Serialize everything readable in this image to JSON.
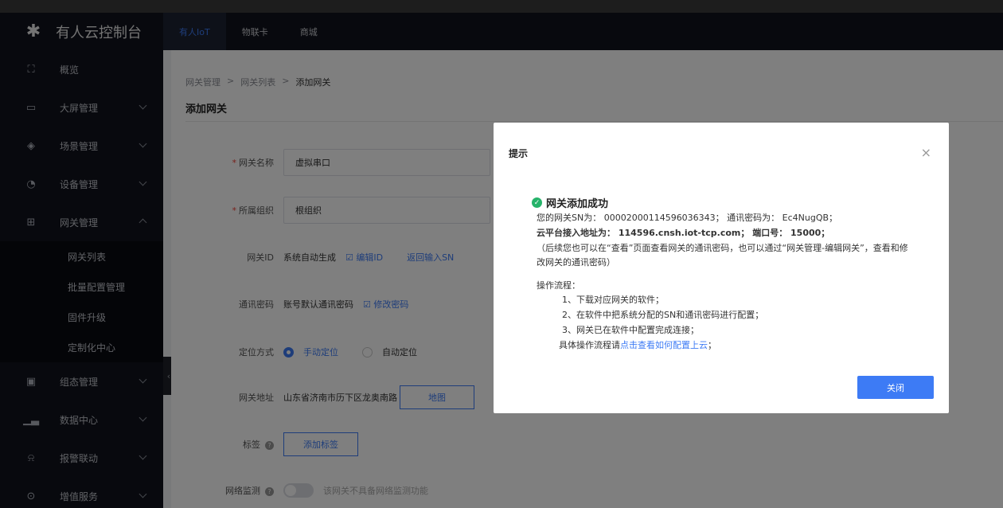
{
  "app": {
    "title": "有人云控制台"
  },
  "topbar": {
    "tabs": [
      "有人IoT",
      "物联卡",
      "商城"
    ]
  },
  "sidebar": {
    "items": [
      {
        "label": "概览",
        "icon": "overview-icon"
      },
      {
        "label": "大屏管理",
        "icon": "screen-icon"
      },
      {
        "label": "场景管理",
        "icon": "cube-icon"
      },
      {
        "label": "设备管理",
        "icon": "device-icon"
      },
      {
        "label": "网关管理",
        "icon": "gateway-icon"
      },
      {
        "label": "组态管理",
        "icon": "image-icon"
      },
      {
        "label": "数据中心",
        "icon": "bar-chart-icon"
      },
      {
        "label": "报警联动",
        "icon": "alarm-icon"
      },
      {
        "label": "增值服务",
        "icon": "service-icon"
      }
    ],
    "gateway_sub": [
      "网关列表",
      "批量配置管理",
      "固件升级",
      "定制化中心"
    ]
  },
  "breadcrumb": [
    "网关管理",
    "网关列表",
    "添加网关"
  ],
  "page_title": "添加网关",
  "form": {
    "name_label": "网关名称",
    "name_value": "虚拟串口",
    "org_label": "所属组织",
    "org_value": "根组织",
    "id_label": "网关ID",
    "id_value": "系统自动生成",
    "id_edit": "编辑ID",
    "id_back": "返回输入SN",
    "pwd_label": "通讯密码",
    "pwd_value": "账号默认通讯密码",
    "pwd_edit": "修改密码",
    "loc_label": "定位方式",
    "loc_manual": "手动定位",
    "loc_auto": "自动定位",
    "addr_label": "网关地址",
    "addr_value": "山东省济南市历下区龙奥南路",
    "addr_map": "地图",
    "tag_label": "标签",
    "tag_add": "添加标签",
    "net_label": "网络监测",
    "net_hint": "该网关不具备网络监测功能"
  },
  "modal": {
    "title": "提示",
    "success": "网关添加成功",
    "line1": "您的网关SN为： 00002000114596036343； 通讯密码为： Ec4NugQB；",
    "line2": "云平台接入地址为： 114596.cnsh.iot-tcp.com； 端口号： 15000；",
    "line3": "（后续您也可以在“查看”页面查看网关的通讯密码，也可以通过“网关管理-编辑网关”，查看和修",
    "line4": "改网关的通讯密码）",
    "process_title": "操作流程：",
    "step1": "1、下载对应网关的软件；",
    "step2": "2、在软件中把系统分配的SN和通讯密码进行配置；",
    "step3": "3、网关已在软件中配置完成连接；",
    "detail_prefix": "具体操作流程请",
    "detail_link": "点击查看如何配置上云",
    "detail_suffix": "；",
    "close_btn": "关闭"
  },
  "colors": {
    "accent": "#3d7bf5",
    "success": "#26b36a",
    "sidebar_bg": "#11131c"
  }
}
